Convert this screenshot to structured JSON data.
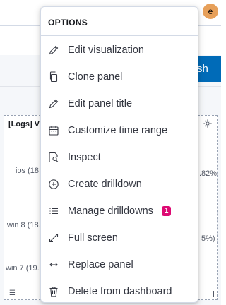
{
  "user": {
    "avatar_initial": "e",
    "avatar_color": "#e7a05a"
  },
  "toolbar": {
    "query_button_label": "sh"
  },
  "panel": {
    "title": "[Logs] Vi",
    "labels": [
      "ios (18.",
      ".82%",
      "win 8 (18.",
      "5%)",
      "win 7 (19."
    ]
  },
  "menu": {
    "title": "OPTIONS",
    "items": [
      {
        "label": "Edit visualization",
        "icon": "pencil-icon"
      },
      {
        "label": "Clone panel",
        "icon": "copy-icon"
      },
      {
        "label": "Edit panel title",
        "icon": "pencil-icon"
      },
      {
        "label": "Customize time range",
        "icon": "calendar-icon"
      },
      {
        "label": "Inspect",
        "icon": "inspect-icon"
      },
      {
        "label": "Create drilldown",
        "icon": "plus-circle-icon"
      },
      {
        "label": "Manage drilldowns",
        "icon": "list-icon",
        "badge": "1"
      },
      {
        "label": "Full screen",
        "icon": "expand-icon"
      },
      {
        "label": "Replace panel",
        "icon": "swap-icon"
      },
      {
        "label": "Delete from dashboard",
        "icon": "trash-icon"
      }
    ]
  },
  "colors": {
    "accent": "#006bb8",
    "badge": "#dd0a73",
    "text": "#343741"
  }
}
